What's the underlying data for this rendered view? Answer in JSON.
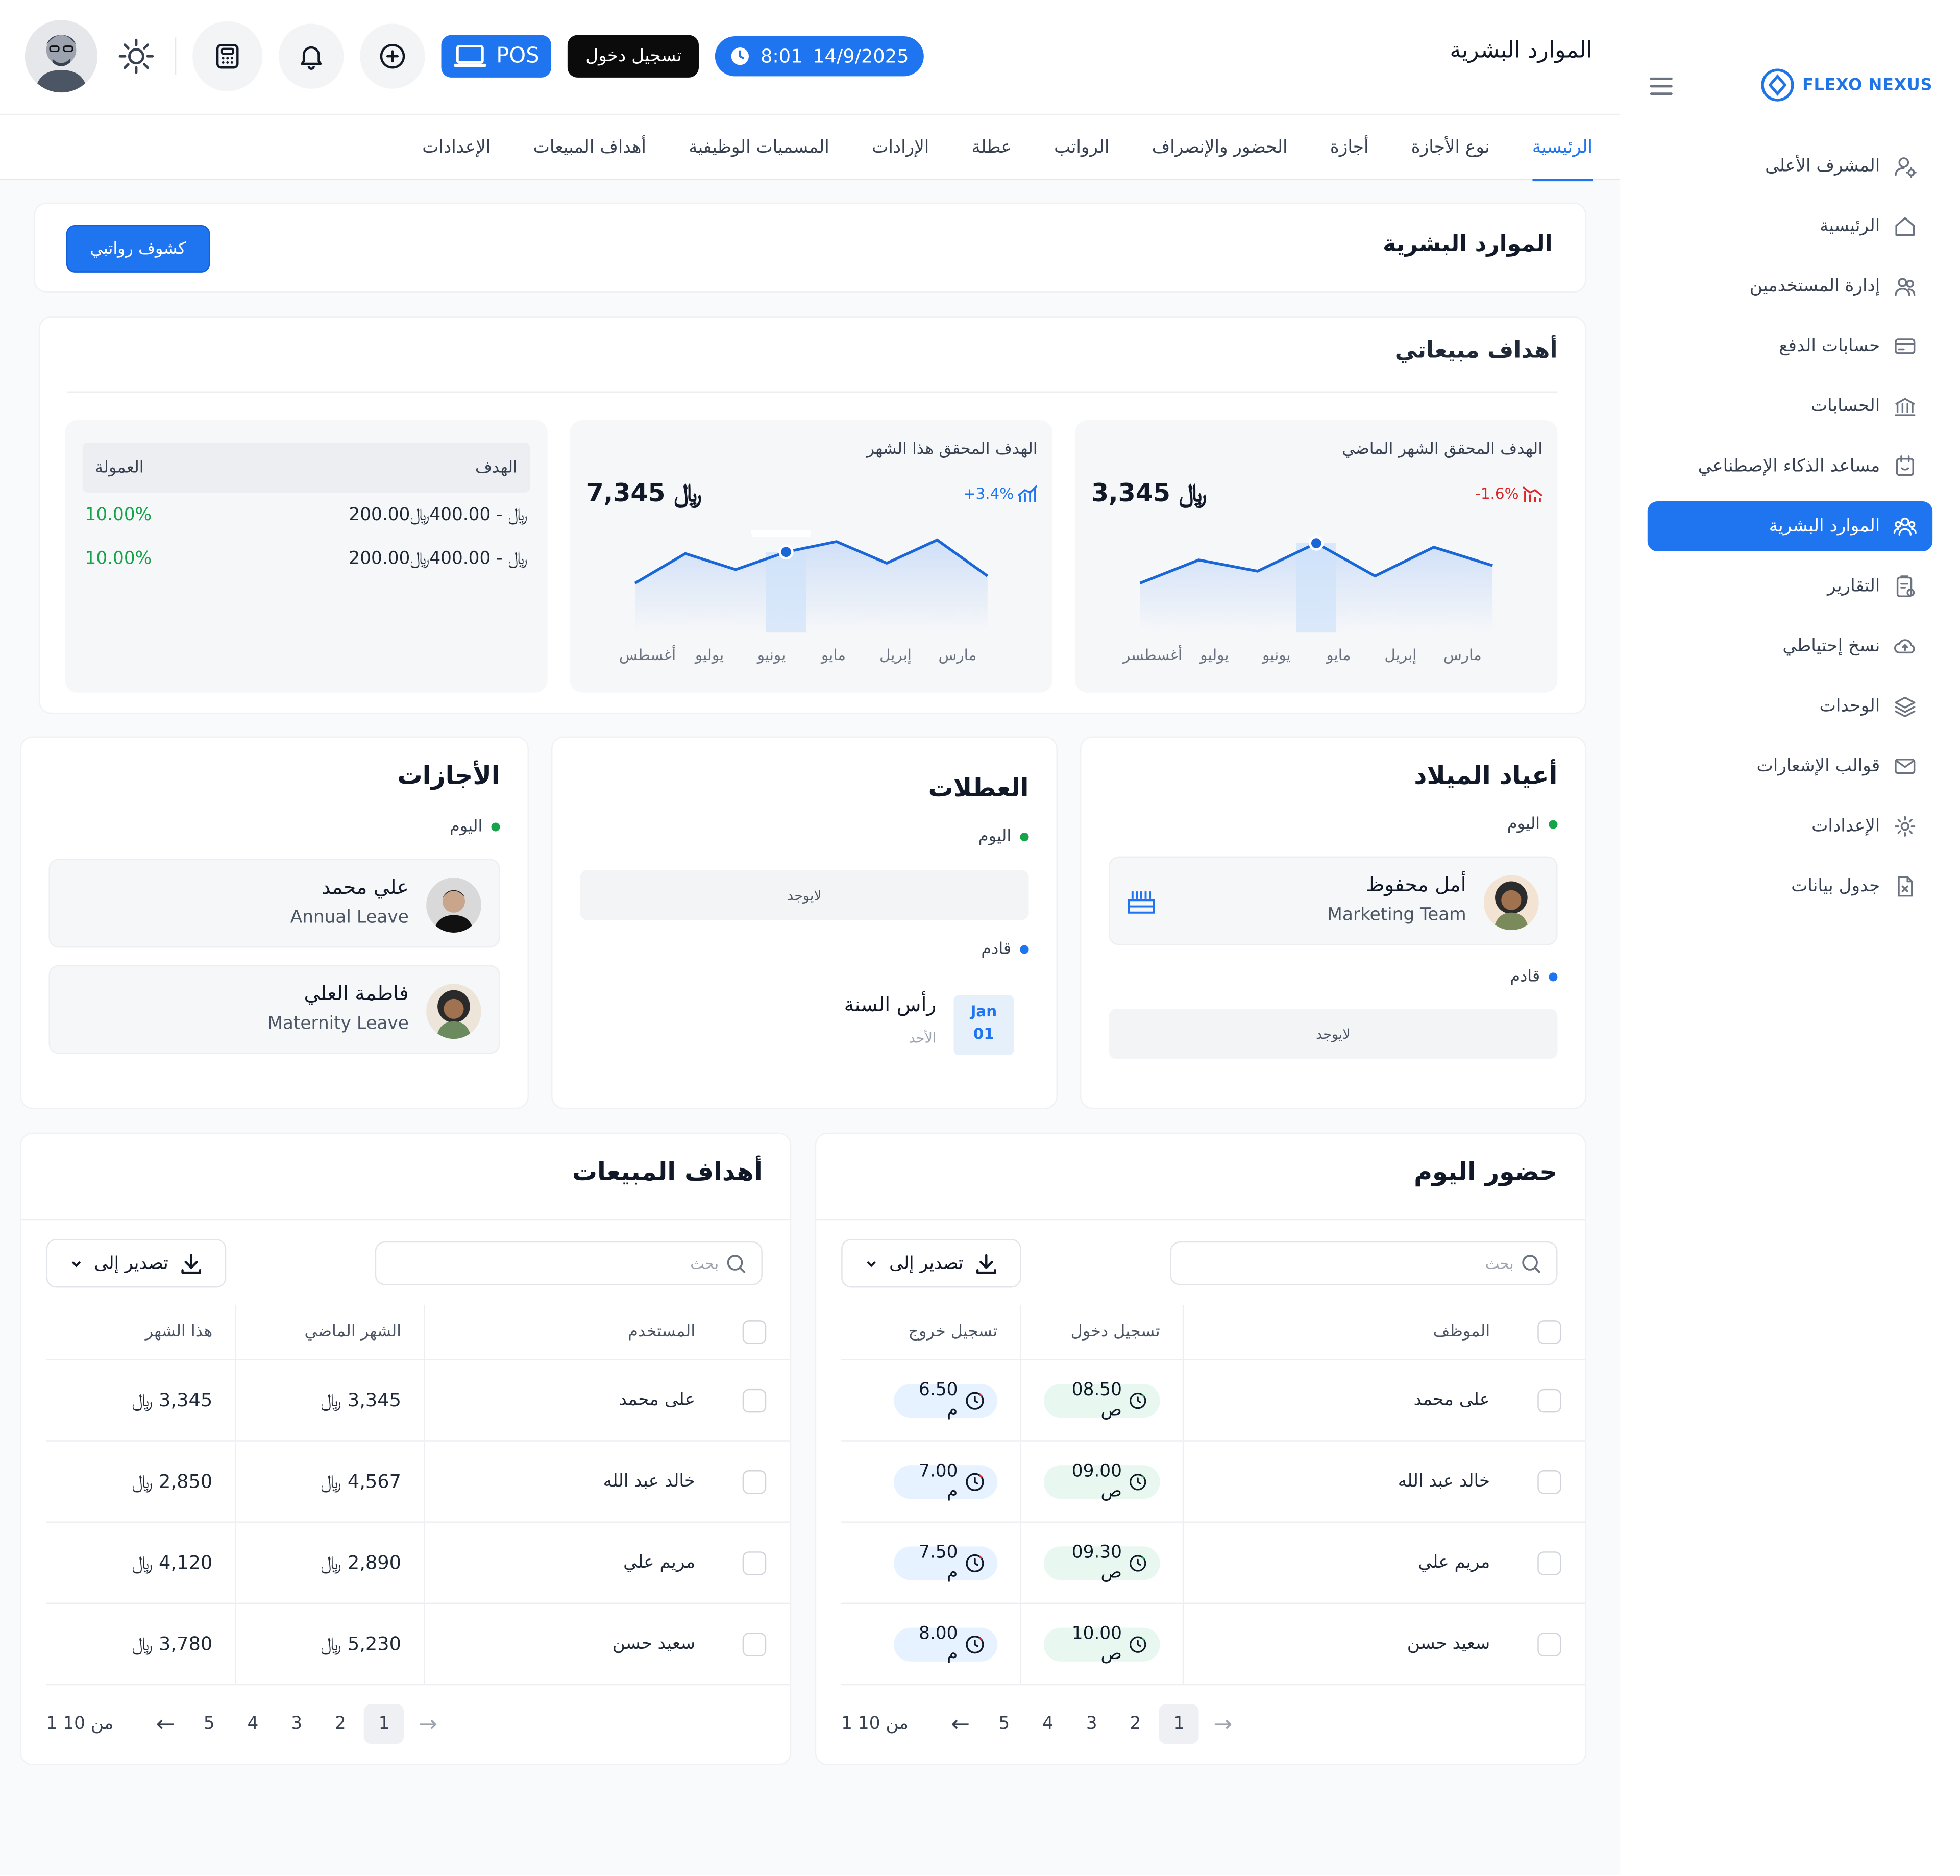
{
  "brand": {
    "name": "FLEXO NEXUS"
  },
  "header": {
    "title": "الموارد البشرية",
    "date": "14/9/2025",
    "time": "8:01",
    "login_label": "تسجيل دخول",
    "pos_label": "POS"
  },
  "sidebar": {
    "items": [
      {
        "label": "المشرف الأعلى",
        "icon": "user-gear-icon",
        "active": false
      },
      {
        "label": "الرئيسية",
        "icon": "home-icon",
        "active": false
      },
      {
        "label": "إدارة المستخدمين",
        "icon": "users-icon",
        "active": false
      },
      {
        "label": "حسابات الدفع",
        "icon": "card-icon",
        "active": false
      },
      {
        "label": "الحسابات",
        "icon": "bank-icon",
        "active": false
      },
      {
        "label": "مساعد الذكاء الإصطناعي",
        "icon": "robot-icon",
        "active": false
      },
      {
        "label": "الموارد البشرية",
        "icon": "team-icon",
        "active": true
      },
      {
        "label": "التقارير",
        "icon": "report-icon",
        "active": false
      },
      {
        "label": "نسخ إحتياطي",
        "icon": "cloud-icon",
        "active": false
      },
      {
        "label": "الوحدات",
        "icon": "layers-icon",
        "active": false
      },
      {
        "label": "قوالب الإشعارات",
        "icon": "mail-icon",
        "active": false
      },
      {
        "label": "الإعدادات",
        "icon": "settings-icon",
        "active": false
      },
      {
        "label": "جدول بيانات",
        "icon": "sheet-icon",
        "active": false
      }
    ]
  },
  "tabs": [
    "الرئيسية",
    "نوع الأجازة",
    "أجازة",
    "الحضور والإنصراف",
    "الرواتب",
    "عطلة",
    "الإرادات",
    "المسميات الوظيفية",
    "أهداف المبيعات",
    "الإعدادات"
  ],
  "page": {
    "title": "الموارد البشرية",
    "payslips_button": "كشوف رواتبي"
  },
  "sales_targets": {
    "title": "أهداف مبيعاتي",
    "last_month": {
      "title": "الهدف المحقق الشهر الماضي",
      "value": "3,345",
      "change": "-1.6%",
      "tooltip": "3,345",
      "months": [
        "مارس",
        "إبريل",
        "مايو",
        "يونيو",
        "يوليو",
        "أغسطسر"
      ],
      "series": [
        0.43,
        0.72,
        0.58,
        0.93,
        0.52,
        0.88,
        0.65
      ],
      "highlight_month": "مايو"
    },
    "this_month": {
      "title": "الهدف المحقق هذا الشهر",
      "value": "7,345",
      "change": "+3.4%",
      "tooltip": "7,345",
      "months": [
        "مارس",
        "إبريل",
        "مايو",
        "يونيو",
        "يوليو",
        "أغسطس"
      ],
      "series": [
        0.43,
        0.8,
        0.6,
        0.82,
        0.95,
        0.68,
        0.97,
        0.52
      ],
      "highlight_month": "يونيو"
    },
    "table": {
      "col_target": "الهدف",
      "col_commission": "العمولة",
      "rows": [
        {
          "target": "200.00﷼ - 400.00﷼",
          "commission": "10.00%"
        },
        {
          "target": "200.00﷼ - 400.00﷼",
          "commission": "10.00%"
        }
      ]
    }
  },
  "birthdays": {
    "title": "أعياد الميلاد",
    "today_label": "اليوم",
    "upcoming_label": "قادم",
    "today": [
      {
        "name": "أمل محفوظ",
        "team": "Marketing Team"
      }
    ],
    "upcoming_empty": "لايوجد"
  },
  "holidays": {
    "title": "العطلات",
    "today_label": "اليوم",
    "today_empty": "لايوجد",
    "upcoming_label": "قادم",
    "upcoming": [
      {
        "name": "رأس السنة",
        "day": "الأحد",
        "month": "Jan",
        "date": "01"
      }
    ]
  },
  "leaves": {
    "title": "الأجازات",
    "today_label": "اليوم",
    "items": [
      {
        "name": "علي محمد",
        "type": "Annual Leave"
      },
      {
        "name": "فاطمة العلي",
        "type": "Maternity Leave"
      }
    ]
  },
  "attendance": {
    "title": "حضور اليوم",
    "search_placeholder": "بحث",
    "export_label": "تصدير إلى",
    "columns": {
      "employee": "الموظف",
      "check_in": "تسجيل دخول",
      "check_out": "تسجيل خروج"
    },
    "rows": [
      {
        "name": "على محمد",
        "in": "08.50 ص",
        "out": "6.50 م"
      },
      {
        "name": "خالد عبد الله",
        "in": "09.00 ص",
        "out": "7.00 م"
      },
      {
        "name": "مريم علي",
        "in": "09.30 ص",
        "out": "7.50 م"
      },
      {
        "name": "سعيد حسن",
        "in": "10.00 ص",
        "out": "8.00 م"
      }
    ],
    "pages": [
      "1",
      "2",
      "3",
      "4",
      "5"
    ],
    "page_info": "1 من 10"
  },
  "sales_table": {
    "title": "أهداف المبيعات",
    "search_placeholder": "بحث",
    "export_label": "تصدير إلى",
    "columns": {
      "user": "المستخدم",
      "last_month": "الشهر الماضي",
      "this_month": "هذا الشهر"
    },
    "rows": [
      {
        "name": "على محمد",
        "last": "3,345 ﷼",
        "this": "3,345 ﷼"
      },
      {
        "name": "خالد عبد الله",
        "last": "4,567 ﷼",
        "this": "2,850 ﷼"
      },
      {
        "name": "مريم علي",
        "last": "2,890 ﷼",
        "this": "4,120 ﷼"
      },
      {
        "name": "سعيد حسن",
        "last": "5,230 ﷼",
        "this": "3,780 ﷼"
      }
    ],
    "pages": [
      "1",
      "2",
      "3",
      "4",
      "5"
    ],
    "page_info": "1 من 10"
  },
  "colors": {
    "accent": "#1f74f0",
    "success": "#16a34a",
    "danger": "#dc2626"
  }
}
